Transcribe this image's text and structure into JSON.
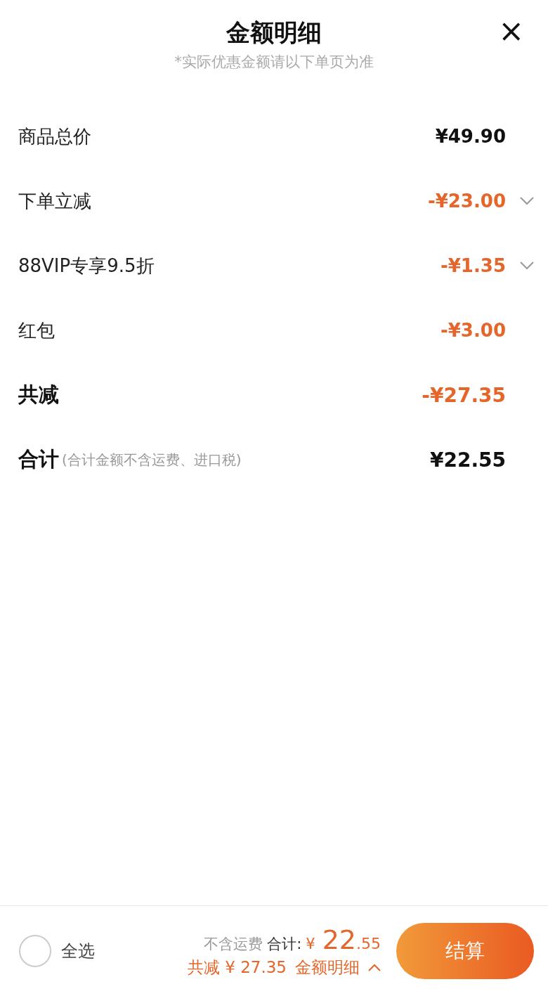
{
  "header": {
    "title": "金额明细",
    "subtitle": "*实际优惠金额请以下单页为准",
    "close": "×"
  },
  "rows": [
    {
      "label": "商品总价",
      "amount": "¥49.90",
      "discount": false,
      "bold": false,
      "expandable": false
    },
    {
      "label": "下单立减",
      "amount": "-¥23.00",
      "discount": true,
      "bold": false,
      "expandable": true
    },
    {
      "label": "88VIP专享9.5折",
      "amount": "-¥1.35",
      "discount": true,
      "bold": false,
      "expandable": true
    },
    {
      "label": "红包",
      "amount": "-¥3.00",
      "discount": true,
      "bold": false,
      "expandable": false
    },
    {
      "label": "共减",
      "amount": "-¥27.35",
      "discount": true,
      "bold": true,
      "expandable": false
    },
    {
      "label": "合计",
      "note": "(合计金额不含运费、进口税)",
      "amount": "¥22.55",
      "discount": false,
      "bold": true,
      "expandable": false
    }
  ],
  "footer": {
    "select_all": {
      "label": "全选",
      "checked": false
    },
    "shipping_note": "不含运费",
    "total_label": "合计:",
    "currency": "¥",
    "total_int": "22",
    "total_dec": ".55",
    "reduction": "共减 ¥ 27.35",
    "details_link": "金额明细",
    "checkout": "结算"
  }
}
